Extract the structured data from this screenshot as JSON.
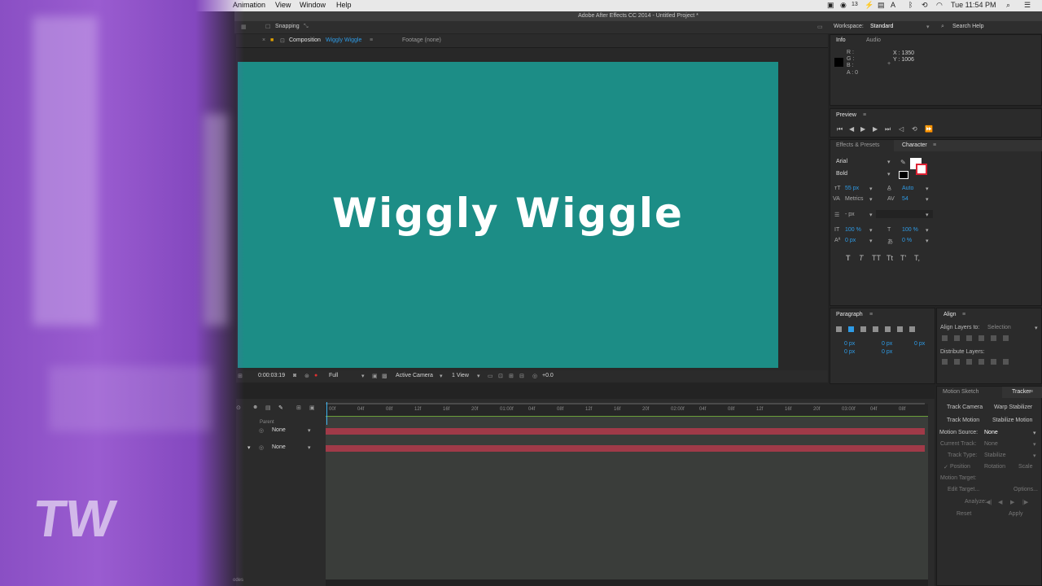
{
  "menubar": {
    "items": [
      "Animation",
      "View",
      "Window",
      "Help"
    ],
    "status_icons": [
      "cc-icon",
      "wifi-icon",
      "bluetooth-icon",
      "volume-icon",
      "search-icon"
    ],
    "cc_count": "13",
    "time": "Tue 11:54 PM"
  },
  "app": {
    "title": "Adobe After Effects CC 2014 - Untitled Project *",
    "snapping": "Snapping",
    "workspace_label": "Workspace:",
    "workspace_value": "Standard",
    "search_help": "Search Help"
  },
  "composition": {
    "tab_prefix": "Composition",
    "tab_name": "Wiggly Wiggle",
    "footage_tab": "Footage (none)",
    "canvas_text": "Wiggly Wiggle",
    "canvas_color": "#1c8d86",
    "timecode": "0:00:03:19",
    "resolution": "Full",
    "camera": "Active Camera",
    "views": "1 View",
    "exposure": "+0.0"
  },
  "info_panel": {
    "tabs": [
      "Info",
      "Audio"
    ],
    "channels": [
      "R :",
      "G :",
      "B :",
      "A : 0"
    ],
    "x": "X : 1350",
    "y": "Y : 1006"
  },
  "preview_panel": {
    "title": "Preview"
  },
  "character_panel": {
    "tabs": [
      "Effects & Presets",
      "Character"
    ],
    "font": "Arial",
    "style": "Bold",
    "size": "55 px",
    "leading": "Auto",
    "kerning": "Metrics",
    "tracking": "54",
    "stroke": "- px",
    "vscale": "100 %",
    "hscale": "100 %",
    "baseline": "0 px",
    "tsume": "0 %",
    "styles": [
      "T",
      "T",
      "TT",
      "Tt",
      "T'",
      "T,"
    ]
  },
  "paragraph_panel": {
    "title": "Paragraph",
    "values": [
      "0 px",
      "0 px",
      "0 px",
      "0 px",
      "0 px"
    ]
  },
  "align_panel": {
    "title": "Align",
    "align_to_label": "Align Layers to:",
    "align_to_value": "Selection",
    "distribute_label": "Distribute Layers:"
  },
  "tracker_panel": {
    "tabs": [
      "Motion Sketch",
      "Tracker"
    ],
    "buttons": [
      "Track Camera",
      "Warp Stabilizer",
      "Track Motion",
      "Stabilize Motion"
    ],
    "motion_source_label": "Motion Source:",
    "motion_source_value": "None",
    "current_track_label": "Current Track:",
    "current_track_value": "None",
    "track_type_label": "Track Type:",
    "track_type_value": "Stabilize",
    "checks": [
      "Position",
      "Rotation",
      "Scale"
    ],
    "motion_target_label": "Motion Target:",
    "edit_target": "Edit Target...",
    "options": "Options...",
    "analyze": "Analyze:",
    "reset": "Reset",
    "apply": "Apply"
  },
  "timeline": {
    "parent_header": "Parent",
    "rows": [
      {
        "parent": "None"
      },
      {
        "parent": "None"
      }
    ],
    "ticks": [
      "00f",
      "04f",
      "08f",
      "12f",
      "16f",
      "20f",
      "01:00f",
      "04f",
      "08f",
      "12f",
      "16f",
      "20f",
      "02:00f",
      "04f",
      "08f",
      "12f",
      "16f",
      "20f",
      "03:00f",
      "04f",
      "08f"
    ],
    "footer": "odes"
  },
  "overlay": {
    "letters": "TW"
  }
}
